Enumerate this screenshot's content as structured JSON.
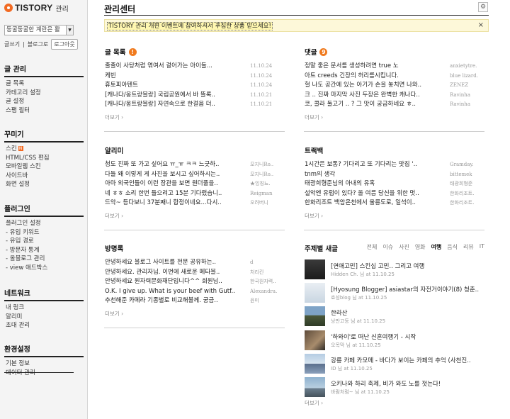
{
  "sidebar": {
    "logo_text": "TISTORY",
    "logo_sub": "관리",
    "blog_name": "둥굴둥굴한 계란은 활",
    "quick_links": [
      "글쓰기",
      "블로그로"
    ],
    "logout_label": "로그아웃",
    "groups": [
      {
        "title": "글 관리",
        "items": [
          {
            "label": "글 목록"
          },
          {
            "label": "카테고리 설정"
          },
          {
            "label": "글 설정"
          },
          {
            "label": "스팸 필터"
          }
        ]
      },
      {
        "title": "꾸미기",
        "items": [
          {
            "label": "스킨",
            "badge": "N"
          },
          {
            "label": "HTML/CSS 편집"
          },
          {
            "label": "모바일웹 스킨"
          },
          {
            "label": "사이드바"
          },
          {
            "label": "화면 설정"
          }
        ]
      },
      {
        "title": "플러그인",
        "items": [
          {
            "label": "플러그인 설정"
          },
          {
            "label": "- 유입 키워드"
          },
          {
            "label": "- 유입 경로"
          },
          {
            "label": "- 방문자 통계"
          },
          {
            "label": "- 올블로그 관리"
          },
          {
            "label": "- view 애드박스"
          }
        ]
      },
      {
        "title": "네트워크",
        "items": [
          {
            "label": "내 링크"
          },
          {
            "label": "알리미"
          },
          {
            "label": "초대 관리"
          }
        ]
      },
      {
        "title": "환경설정",
        "items": [
          {
            "label": "기본 정보"
          },
          {
            "label": "데이터 관리"
          }
        ]
      }
    ]
  },
  "main": {
    "title": "관리센터",
    "notice": "TISTORY 관리 개편 이벤트에 참여하셔서 푸짐한 상품 받으세요!",
    "notice_close": "×",
    "more_label": "더보기 ›",
    "posts": {
      "title": "글 목록",
      "badge": "!",
      "rows": [
        {
          "text": "줄줄이 사탕처럼 엮여서 걸어가는 아이들...",
          "meta": "11.10.24"
        },
        {
          "text": "케빈",
          "meta": "11.10.24"
        },
        {
          "text": "휴토피아텐트",
          "meta": "11.10.24"
        },
        {
          "text": "[캐나다/옹트랑블랑] 국립공원에서 바 뜰록..",
          "meta": "11.10.21"
        },
        {
          "text": "[캐나다/옹트랑블랑] 자연속으로 한걸음 더..",
          "meta": "11.10.21"
        }
      ]
    },
    "comments": {
      "title": "댓글",
      "badge": "9",
      "rows": [
        {
          "text": "정말 좋은 문서를 생성하려면 true 노",
          "meta": "anxietytre."
        },
        {
          "text": "아트 creeds 긴장의 허리를시킵니다.",
          "meta": "blue lizard."
        },
        {
          "text": "헐 나도 공간에 있는 아기가 손을 놓치면 나와..",
          "meta": "ZENEZ"
        },
        {
          "text": "크 .. 진짜 마지막 사진 두장은 완벽한 캐나다..",
          "meta": "Ravinha"
        },
        {
          "text": "코, 콜라 둘고기 .. ? 그 맛이 궁금하네요 ㅎ..",
          "meta": "Ravinha"
        }
      ]
    },
    "alerts": {
      "title": "알리미",
      "rows": [
        {
          "text": "청도 진짜 또 가고 싶어요 ㅠ_ㅠ ㅋㅋ 느긋하..",
          "meta": "모지니Ro.."
        },
        {
          "text": "다들 왜 이렇게 게 사진을 보시고 싶어하시는..",
          "meta": "모지니Ro.."
        },
        {
          "text": "아마 외국인들이 이런 장관을 보면 원더풀을..",
          "meta": "★잉칭뇨."
        },
        {
          "text": "네 ㅎㅎ 소리 한번 들으려고 15분 기다렸습니..",
          "meta": "Reigman"
        },
        {
          "text": "드악~ 등다보니 37분째니 합정이네요...다시..",
          "meta": "오려버니"
        }
      ]
    },
    "trackbacks": {
      "title": "트랙백",
      "rows": [
        {
          "text": "1시간은 보통? 기다리고 또 기다리는 맛집 '..",
          "meta": "Gramday."
        },
        {
          "text": "tnm의 생각",
          "meta": "bittemek"
        },
        {
          "text": "태광희형준님의 아내의 유혹",
          "meta": "태광희형준"
        },
        {
          "text": "설악엔 유럽이 있다? 올 여름 당신을 위한 멋..",
          "meta": "한화리조트."
        },
        {
          "text": "한화리조트 백암온천에서 울릉도로, 일석이..",
          "meta": "한화리조트."
        }
      ]
    },
    "guestbook": {
      "title": "방명록",
      "rows": [
        {
          "text": "안녕하세요 블로그 사이트를 전문 공유하는..",
          "meta": "d"
        },
        {
          "text": "안녕하세요. 관리자님. 이번에 새로운 메타블..",
          "meta": "처리킨"
        },
        {
          "text": "안녕하세요 원자력문화재단입니다^^ 회원님..",
          "meta": "한국원자력.."
        },
        {
          "text": "O.K. I give up. What is your beef with Gutf..",
          "meta": "Alexandra."
        },
        {
          "text": "추천해준 카메라 기종별로 비교해볼께. 궁금..",
          "meta": "윤미"
        }
      ]
    },
    "topics": {
      "title": "주제별 새글",
      "tabs": [
        "전체",
        "이슈",
        "사진",
        "영화",
        "여행",
        "음식",
        "리뷰",
        "IT"
      ],
      "active_tab": "여행",
      "rows": [
        {
          "title": "[연애고민] 스킨십 고민.. 그리고 여행",
          "meta": "Hidden Ch. 님 at 11.10.25"
        },
        {
          "title": "[Hyosung Blogger] asiastar의 자전거이야기(8) 청춘..",
          "meta": "효성blog 님 at 11.10.25"
        },
        {
          "title": "한라산",
          "meta": "낭만고등 님 at 11.10.25"
        },
        {
          "title": "'하와이'로 떠난 신혼여행기 - 시작",
          "meta": "오목막 님 at 11.10.25"
        },
        {
          "title": "강릉 카페 카모메 - 바다가 보이는 카페의 추억 (사천진..",
          "meta": "ID 님 at 11.10.25"
        },
        {
          "title": "오키나와 하리 축제, 비가 와도 노를 젓는다!",
          "meta": "바람처럼~ 님 at 11.10.25"
        }
      ]
    }
  },
  "colors": {
    "accent": "#f26a22",
    "badge": "#f07a1e",
    "notice_bg": "#fdf8d9"
  },
  "icons": {
    "settings": "gear-icon",
    "close": "close-icon"
  }
}
